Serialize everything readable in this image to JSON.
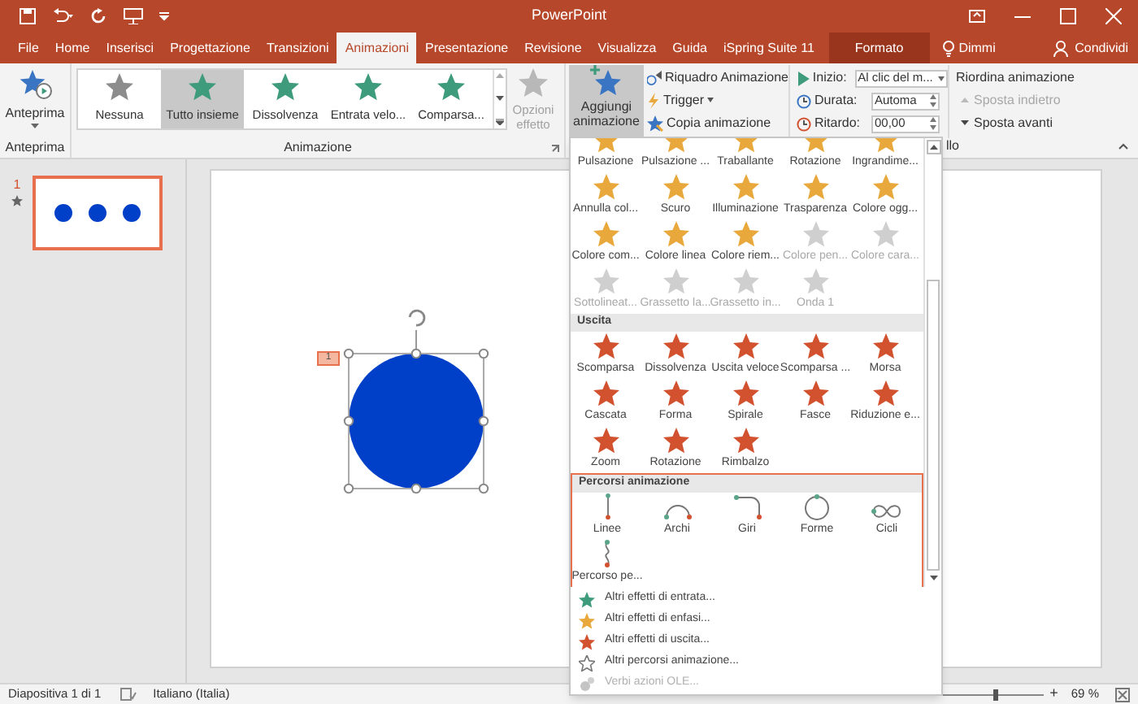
{
  "title_bar": {
    "title": "PowerPoint"
  },
  "tabs": [
    {
      "label": "File",
      "selected": false,
      "kind": "normal"
    },
    {
      "label": "Home",
      "selected": false,
      "kind": "normal"
    },
    {
      "label": "Inserisci",
      "selected": false,
      "kind": "normal"
    },
    {
      "label": "Progettazione",
      "selected": false,
      "kind": "normal"
    },
    {
      "label": "Transizioni",
      "selected": false,
      "kind": "normal"
    },
    {
      "label": "Animazioni",
      "selected": true,
      "kind": "normal"
    },
    {
      "label": "Presentazione",
      "selected": false,
      "kind": "normal"
    },
    {
      "label": "Revisione",
      "selected": false,
      "kind": "normal"
    },
    {
      "label": "Visualizza",
      "selected": false,
      "kind": "normal"
    },
    {
      "label": "Guida",
      "selected": false,
      "kind": "normal"
    },
    {
      "label": "iSpring Suite 11",
      "selected": false,
      "kind": "normal"
    },
    {
      "label": "Formato",
      "selected": false,
      "kind": "contextual"
    }
  ],
  "tell_me": "Dimmi",
  "share": "Condividi",
  "ribbon": {
    "preview": {
      "label": "Anteprima",
      "group": "Anteprima"
    },
    "gallery": {
      "group": "Animazione",
      "items": [
        {
          "label": "Nessuna",
          "selected": false,
          "kind": "none"
        },
        {
          "label": "Tutto insieme",
          "selected": true,
          "kind": "entrance"
        },
        {
          "label": "Dissolvenza",
          "selected": false,
          "kind": "entrance"
        },
        {
          "label": "Entrata velo...",
          "selected": false,
          "kind": "entrance"
        },
        {
          "label": "Comparsa...",
          "selected": false,
          "kind": "entrance"
        }
      ]
    },
    "effect_options": {
      "label": "Opzioni effetto",
      "disabled": true
    },
    "add_animation": {
      "label": "Aggiungi animazione",
      "expanded": true
    },
    "advanced": [
      {
        "label": "Riquadro Animazione",
        "kind": "pane"
      },
      {
        "label": "Trigger",
        "kind": "trigger"
      },
      {
        "label": "Copia animazione",
        "kind": "copy"
      }
    ],
    "timing": {
      "start_label": "Inizio:",
      "start_value": "Al clic del m...",
      "duration_label": "Durata:",
      "duration_value": "Automa",
      "delay_label": "Ritardo:",
      "delay_value": "00,00",
      "group": "llo"
    },
    "reorder": {
      "title": "Riordina animazione",
      "items": [
        {
          "label": "Sposta indietro",
          "disabled": true,
          "kind": "up"
        },
        {
          "label": "Sposta avanti",
          "disabled": false,
          "kind": "down"
        }
      ]
    }
  },
  "thumbnails": [
    {
      "number": "1",
      "selected": true
    }
  ],
  "slide": {
    "animation_tag": "1"
  },
  "effects_menu": {
    "sections": [
      {
        "kind": "emphasis",
        "items": [
          {
            "label": "Pulsazione",
            "disabled": false
          },
          {
            "label": "Pulsazione ...",
            "disabled": false
          },
          {
            "label": "Traballante",
            "disabled": false
          },
          {
            "label": "Rotazione",
            "disabled": false
          },
          {
            "label": "Ingrandime...",
            "disabled": false
          },
          {
            "label": "Annulla col...",
            "disabled": false
          },
          {
            "label": "Scuro",
            "disabled": false
          },
          {
            "label": "Illuminazione",
            "disabled": false
          },
          {
            "label": "Trasparenza",
            "disabled": false
          },
          {
            "label": "Colore ogg...",
            "disabled": false
          },
          {
            "label": "Colore com...",
            "disabled": false
          },
          {
            "label": "Colore linea",
            "disabled": false
          },
          {
            "label": "Colore riem...",
            "disabled": false
          },
          {
            "label": "Colore pen...",
            "disabled": true
          },
          {
            "label": "Colore cara...",
            "disabled": true
          },
          {
            "label": "Sottolineat...",
            "disabled": true
          },
          {
            "label": "Grassetto la...",
            "disabled": true
          },
          {
            "label": "Grassetto in...",
            "disabled": true
          },
          {
            "label": "Onda 1",
            "disabled": true
          }
        ]
      },
      {
        "kind": "exit",
        "header": "Uscita",
        "highlighted": false,
        "items": [
          {
            "label": "Scomparsa"
          },
          {
            "label": "Dissolvenza"
          },
          {
            "label": "Uscita veloce"
          },
          {
            "label": "Scomparsa ..."
          },
          {
            "label": "Morsa"
          },
          {
            "label": "Cascata"
          },
          {
            "label": "Forma"
          },
          {
            "label": "Spirale"
          },
          {
            "label": "Fasce"
          },
          {
            "label": "Riduzione e..."
          },
          {
            "label": "Zoom"
          },
          {
            "label": "Rotazione"
          },
          {
            "label": "Rimbalzo"
          }
        ]
      },
      {
        "kind": "path",
        "header": "Percorsi animazione",
        "highlighted": true,
        "items": [
          {
            "label": "Linee",
            "kind": "line"
          },
          {
            "label": "Archi",
            "kind": "arc"
          },
          {
            "label": "Giri",
            "kind": "turn"
          },
          {
            "label": "Forme",
            "kind": "circle"
          },
          {
            "label": "Cicli",
            "kind": "loop"
          },
          {
            "label": "Percorso pe...",
            "kind": "custom"
          }
        ]
      }
    ],
    "more": [
      {
        "label": "Altri effetti di entrata...",
        "kind": "entrance",
        "disabled": false
      },
      {
        "label": "Altri effetti di enfasi...",
        "kind": "emphasis",
        "disabled": false
      },
      {
        "label": "Altri effetti di uscita...",
        "kind": "exit",
        "disabled": false
      },
      {
        "label": "Altri percorsi animazione...",
        "kind": "path",
        "disabled": false
      },
      {
        "label": "Verbi azioni OLE...",
        "kind": "ole",
        "disabled": true
      }
    ]
  },
  "status_bar": {
    "slide": "Diapositiva 1 di 1",
    "language": "Italiano (Italia)",
    "zoom": "69 %",
    "zoom_in": "+",
    "zoom_slider": {
      "level": 0.55
    }
  }
}
